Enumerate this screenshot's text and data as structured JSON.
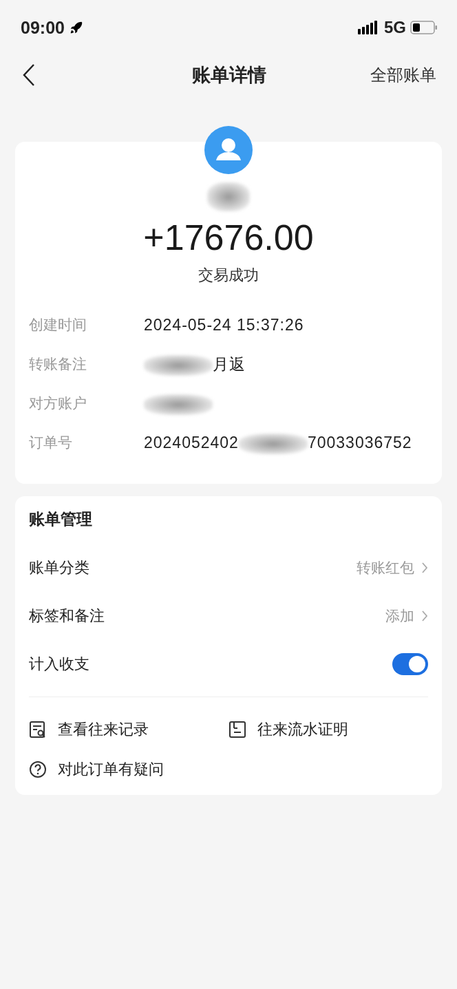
{
  "status_bar": {
    "time": "09:00",
    "network": "5G"
  },
  "nav": {
    "title": "账单详情",
    "action": "全部账单"
  },
  "summary": {
    "amount": "+17676.00",
    "status": "交易成功"
  },
  "details": [
    {
      "label": "创建时间",
      "segments": [
        {
          "kind": "text",
          "text": "2024-05-24  15:37:26"
        }
      ]
    },
    {
      "label": "转账备注",
      "segments": [
        {
          "kind": "redacted"
        },
        {
          "kind": "text",
          "text": "月返"
        }
      ]
    },
    {
      "label": "对方账户",
      "segments": [
        {
          "kind": "redacted"
        }
      ]
    },
    {
      "label": "订单号",
      "segments": [
        {
          "kind": "text",
          "text": "2024052402"
        },
        {
          "kind": "redacted"
        },
        {
          "kind": "text",
          "text": "70033036752"
        }
      ]
    }
  ],
  "management": {
    "title": "账单管理",
    "rows": [
      {
        "kind": "link",
        "label": "账单分类",
        "value": "转账红包"
      },
      {
        "kind": "link",
        "label": "标签和备注",
        "value": "添加"
      },
      {
        "kind": "toggle",
        "label": "计入收支",
        "on": true
      }
    ],
    "actions": [
      {
        "kind": "records",
        "label": "查看往来记录"
      },
      {
        "kind": "statement",
        "label": "往来流水证明"
      },
      {
        "kind": "question",
        "label": "对此订单有疑问"
      }
    ]
  }
}
